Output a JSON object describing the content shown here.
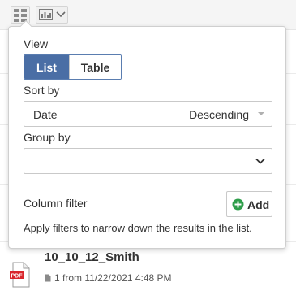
{
  "toolbar": {
    "layout_button_icon": "list-layout-icon",
    "view_button_icon": "chart-view-icon",
    "view_button_chevron": "chevron-down-icon"
  },
  "popup": {
    "view_label": "View",
    "view_options": [
      {
        "label": "List",
        "active": true
      },
      {
        "label": "Table",
        "active": false
      }
    ],
    "sort_label": "Sort by",
    "sort_value": "Date",
    "sort_order": "Descending",
    "group_label": "Group by",
    "group_value": "",
    "column_filter_label": "Column filter",
    "add_label": "Add",
    "hint": "Apply filters to narrow down the results in the list."
  },
  "list": {
    "items": [
      {
        "title": "10_10_12_Smith",
        "meta": "1 from 11/22/2021 4:48 PM",
        "file_type": "PDF"
      }
    ]
  },
  "colors": {
    "accent": "#4a6ea5",
    "add_icon": "#2e9e4a",
    "pdf_red": "#d9262c"
  }
}
